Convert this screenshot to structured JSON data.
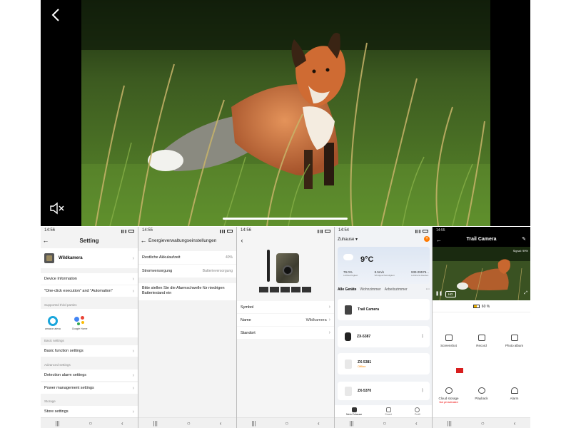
{
  "viewer": {
    "back_icon": "back-arrow-icon",
    "mute_icon": "speaker-muted-icon",
    "photo_subject": "fox"
  },
  "screen1": {
    "status_time": "14:56",
    "title": "Setting",
    "device_name": "Wildkamera",
    "rows": {
      "device_info": "Device Information",
      "one_click": "\"One-click execution\" and \"Automation\"",
      "basic_function": "Basic function settings",
      "detection_alarm": "Detection alarm settings",
      "power_mgmt": "Power management settings",
      "store": "Store settings"
    },
    "sections": {
      "third_parties": "Supported third parties",
      "basic": "Basic settings",
      "advanced": "Advanced settings",
      "storage": "Storage"
    },
    "assistants": {
      "alexa": "amazon alexa",
      "google": "Google Home"
    }
  },
  "screen2": {
    "status_time": "14:55",
    "title": "Energieverwaltungseinstellungen",
    "rows": {
      "battery_left_label": "Restliche Akkulaufzeit",
      "battery_left_value": "40%",
      "power_supply_label": "Stromversorgung",
      "power_supply_value": "Batterieversorgung"
    },
    "note": "Bitte stellen Sie die Alarmschwelle für niedrigen Batteriestand ein"
  },
  "screen3": {
    "status_time": "14:56",
    "rows": {
      "symbol": "Symbol",
      "name_label": "Name",
      "name_value": "Wildkamera",
      "location": "Standort"
    }
  },
  "screen4": {
    "status_time": "14:54",
    "home": "Zuhause",
    "weather": {
      "temp": "9°C",
      "humidity": "79.0%",
      "humidity_label": "Luftfeuchtigkeit",
      "wind": "8.5m/s",
      "wind_label": "Windgeschwindigkeit",
      "pressure": "939.09576...",
      "pressure_label": "Luftdruck draußen"
    },
    "rooms": {
      "all": "Alle Geräte",
      "living": "Wohnzimmer",
      "work": "Arbeitszimmer",
      "more": "···"
    },
    "devices": {
      "d1": "Trail Camera",
      "d2": "ZX-5387",
      "d3": "ZX-5381",
      "d3_status": "Offline",
      "d4": "ZX-5370"
    },
    "tabs": {
      "home": "Mein Zuhause",
      "smart": "Smart",
      "profile": "Profil"
    }
  },
  "screen5": {
    "status_time": "14:55",
    "title": "Trail Camera",
    "signal": "Signal: 99%",
    "hd": "HD",
    "battery": "60 %",
    "battery_level": 0.6,
    "buttons": {
      "screenshot": "Screenshot",
      "record": "Record",
      "photo_album": "Photo album",
      "cloud_storage": "Cloud storage",
      "cloud_status": "Not yet activated",
      "playback": "Playback",
      "alarm": "Alarm"
    }
  },
  "nav": {
    "recent": "|||",
    "home": "○",
    "back": "‹"
  },
  "colors": {
    "accent_orange": "#ff7a00",
    "alexa_blue": "#1aa6dc",
    "battery_yellow": "#f3b600",
    "alert_red": "#e00000"
  }
}
